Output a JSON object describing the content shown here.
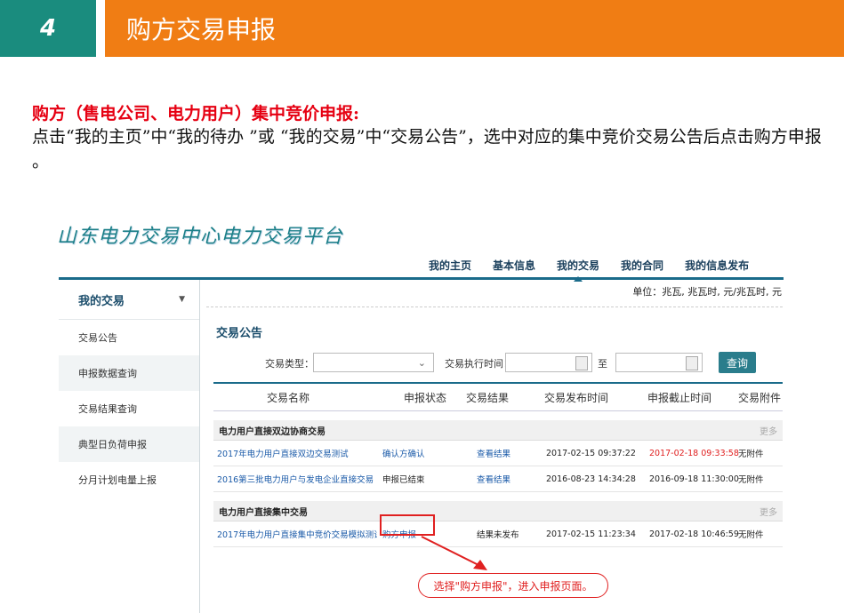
{
  "slide": {
    "number": "4",
    "title": "购方交易申报",
    "heading": "购方（售电公司、电力用户）集中竞价申报:",
    "description": "点击“我的主页”中“我的待办 ”或 “我的交易”中“交易公告”，选中对应的集中竞价交易公告后点击购方申报 。"
  },
  "app": {
    "logo": "山东电力交易中心电力交易平台",
    "topnav": [
      "我的主页",
      "基本信息",
      "我的交易",
      "我的合同",
      "我的信息发布"
    ],
    "active_nav": "我的交易",
    "units": "单位：兆瓦, 兆瓦时, 元/兆瓦时, 元"
  },
  "sidebar": {
    "title": "我的交易",
    "items": [
      "交易公告",
      "申报数据查询",
      "交易结果查询",
      "典型日负荷申报",
      "分月计划电量上报"
    ]
  },
  "main": {
    "section_title": "交易公告",
    "filters": {
      "type_label": "交易类型：",
      "type_value": "",
      "time_label": "交易执行时间：",
      "to_label": "至",
      "query_button": "查询"
    },
    "columns": [
      "交易名称",
      "申报状态",
      "交易结果",
      "交易发布时间",
      "申报截止时间",
      "交易附件"
    ],
    "groups": [
      {
        "title": "电力用户直接双边协商交易",
        "more": "更多",
        "rows": [
          {
            "name": "2017年电力用户直接双边交易测试",
            "status": "确认方确认",
            "result": "查看结果",
            "publish": "2017-02-15 09:37:22",
            "deadline": "2017-02-18 09:33:58",
            "attach": "无附件"
          },
          {
            "name": "2016第三批电力用户与发电企业直接交易",
            "status": "申报已结束",
            "result": "查看结果",
            "publish": "2016-08-23 14:34:28",
            "deadline": "2016-09-18 11:30:00",
            "attach": "无附件"
          }
        ]
      },
      {
        "title": "电力用户直接集中交易",
        "more": "更多",
        "rows": [
          {
            "name": "2017年电力用户直接集中竞价交易模拟测试",
            "status": "购方申报",
            "result": "结果未发布",
            "publish": "2017-02-15 11:23:34",
            "deadline": "2017-02-18 10:46:59",
            "attach": "无附件"
          }
        ]
      }
    ],
    "callout": "选择\"购方申报\"，进入申报页面。"
  },
  "colors": {
    "teal": "#1a8c7e",
    "orange": "#f07d14",
    "red": "#e02020",
    "nav": "#1a6b8a"
  }
}
